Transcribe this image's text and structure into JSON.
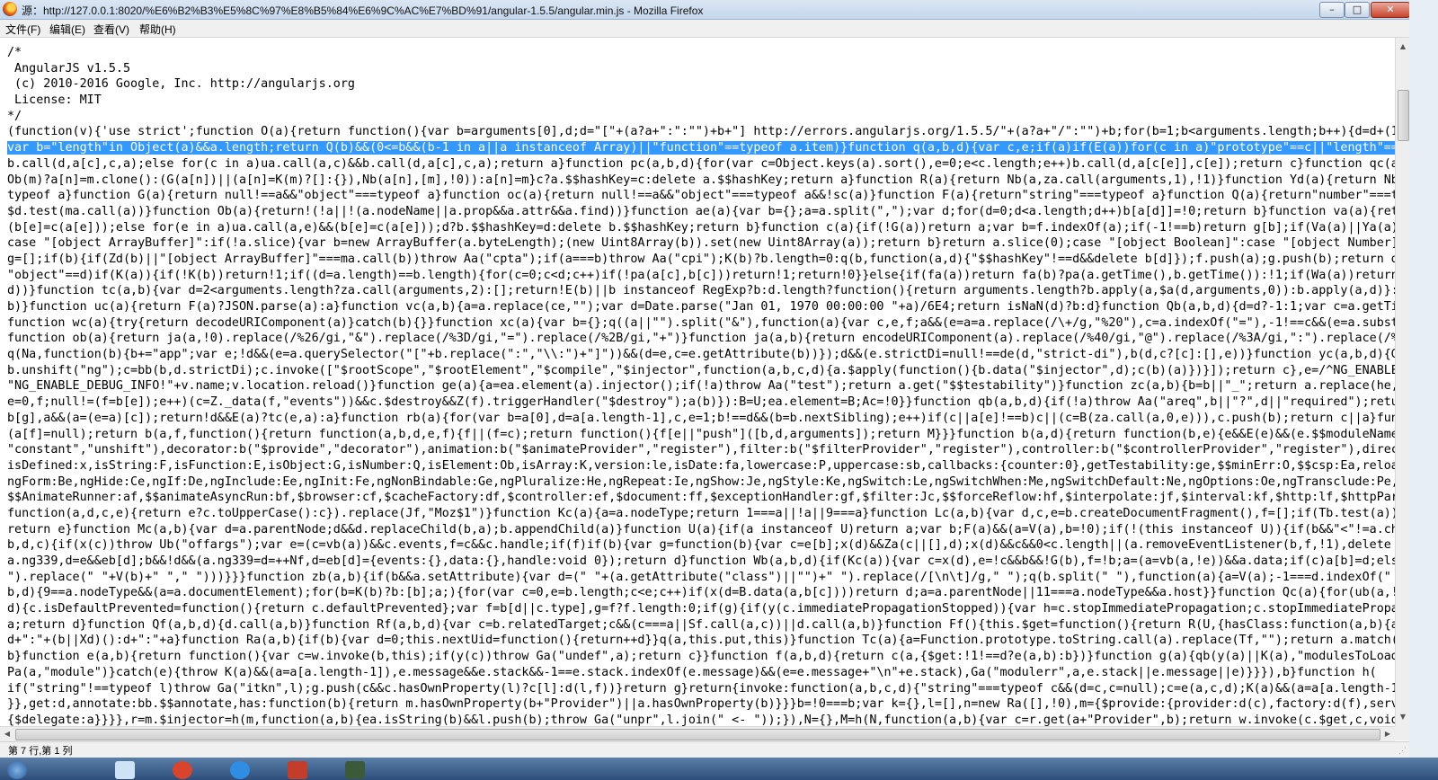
{
  "window": {
    "title": "源：http://127.0.0.1:8020/%E6%B2%B3%E5%8C%97%E8%B5%84%E6%9C%AC%E7%BD%91/angular-1.5.5/angular.min.js - Mozilla Firefox",
    "minimize": "–",
    "maximize": "□",
    "close": "✕"
  },
  "menu": [
    "文件(F)",
    "编辑(E)",
    "查看(V)",
    "帮助(H)"
  ],
  "code": {
    "pre_lines": [
      "/*",
      " AngularJS v1.5.5",
      " (c) 2010-2016 Google, Inc. http://angularjs.org",
      " License: MIT",
      "*/",
      "(function(v){'use strict';function O(a){return function(){var b=arguments[0],d;d=\"[\"+(a?a+\":\":\"\")+b+\"] http://errors.angularjs.org/1.5.5/\"+(a?a+\"/\":\"\")+b;for(b=1;b<arguments.length;b++){d=d+(1==b?\""
    ],
    "highlighted_line": "var b=\"length\"in Object(a)&&a.length;return Q(b)&&(0<=b&&(b-1 in a||a instanceof Array)||\"function\"==typeof a.item)}function q(a,b,d){var c,e;if(a)if(E(a))for(c in a)\"prototype\"==c||\"length\"==c||\"n",
    "post_lines": [
      "b.call(d,a[c],c,a);else for(c in a)ua.call(a,c)&&b.call(d,a[c],c,a);return a}function pc(a,b,d){for(var c=Object.keys(a).sort(),e=0;e<c.length;e++)b.call(d,a[c[e]],c[e]);return c}function qc(a){ret",
      "Ob(m)?a[n]=m.clone():(G(a[n])||(a[n]=K(m)?[]:{}),Nb(a[n],[m],!0)):a[n]=m}c?a.$$hashKey=c:delete a.$$hashKey;return a}function R(a){return Nb(a,za.call(arguments,1),!1)}function Yd(a){return Nb(a,z",
      "typeof a}function G(a){return null!==a&&\"object\"===typeof a}function oc(a){return null!==a&&\"object\"===typeof a&&!sc(a)}function F(a){return\"string\"===typeof a}function Q(a){return\"number\"===typeof",
      "$d.test(ma.call(a))}function Ob(a){return!(!a||!(a.nodeName||a.prop&&a.attr&&a.find))}function ae(a){var b={};a=a.split(\",\");var d;for(d=0;d<a.length;d++)b[a[d]]=!0;return b}function va(a){return P",
      "(b[e]=c(a[e]));else for(e in a)ua.call(a,e)&&(b[e]=c(a[e]));d?b.$$hashKey=d:delete b.$$hashKey;return b}function c(a){if(!G(a))return a;var b=f.indexOf(a);if(-1!==b)return g[b];if(Va(a)||Ya(a))thro",
      "case \"[object ArrayBuffer]\":if(!a.slice){var b=new ArrayBuffer(a.byteLength);(new Uint8Array(b)).set(new Uint8Array(a));return b}return a.slice(0);case \"[object Boolean]\":case \"[object Number]\":cas",
      "g=[];if(b){if(Zd(b)||\"[object ArrayBuffer]\"===ma.call(b))throw Aa(\"cpta\");if(a===b)throw Aa(\"cpi\");K(b)?b.length=0:q(b,function(a,d){\"$$hashKey\"!==d&&delete b[d]});f.push(a);g.push(b);return d(a,b)",
      "\"object\"==d)if(K(a)){if(!K(b))return!1;if((d=a.length)==b.length){for(c=0;c<d;c++)if(!pa(a[c],b[c]))return!1;return!0}}else{if(fa(a))return fa(b)?pa(a.getTime(),b.getTime()):!1;if(Wa(a))return Wa(b)",
      "d))}function tc(a,b){var d=2<arguments.length?za.call(arguments,2):[];return!E(b)||b instanceof RegExp?b:d.length?function(){return arguments.length?b.apply(a,$a(d,arguments,0)):b.apply(a,d)}:funct",
      "b)}function uc(a){return F(a)?JSON.parse(a):a}function vc(a,b){a=a.replace(ce,\"\");var d=Date.parse(\"Jan 01, 1970 00:00:00 \"+a)/6E4;return isNaN(d)?b:d}function Qb(a,b,d){d=d?-1:1;var c=a.getTimezon",
      "function wc(a){try{return decodeURIComponent(a)}catch(b){}}function xc(a){var b={};q((a||\"\").split(\"&\"),function(a){var c,e,f;a&&(e=a=a.replace(/\\+/g,\"%20\"),c=a.indexOf(\"=\"),-1!==c&&(e=a.substring(",
      "function ob(a){return ja(a,!0).replace(/%26/gi,\"&\").replace(/%3D/gi,\"=\").replace(/%2B/gi,\"+\")}function ja(a,b){return encodeURIComponent(a).replace(/%40/gi,\"@\").replace(/%3A/gi,\":\").replace(/%24/g,",
      "q(Na,function(b){b+=\"app\";var e;!d&&(e=a.querySelector(\"[\"+b.replace(\":\",\"\\\\:\")+\"]\"))&&(d=e,c=e.getAttribute(b))});d&&(e.strictDi=null!==de(d,\"strict-di\"),b(d,c?[c]:[],e))}function yc(a,b,d){G(d)||",
      "b.unshift(\"ng\");c=bb(b,d.strictDi);c.invoke([\"$rootScope\",\"$rootElement\",\"$compile\",\"$injector\",function(a,b,c,d){a.$apply(function(){b.data(\"$injector\",d);c(b)(a)})}]);return c},e=/^NG_ENABLE_DEBU",
      "\"NG_ENABLE_DEBUG_INFO!\"+v.name;v.location.reload()}function ge(a){a=ea.element(a).injector();if(!a)throw Aa(\"test\");return a.get(\"$$testability\")}function zc(a,b){b=b||\"_\";return a.replace(he,funct",
      "e=0,f;null!=(f=b[e]);e++)(c=Z._data(f,\"events\"))&&c.$destroy&&Z(f).triggerHandler(\"$destroy\");a(b)}):B=U;ea.element=B;Ac=!0}}function qb(a,b,d){if(!a)throw Aa(\"areq\",b||\"?\",d||\"required\");return a}",
      "b[g],a&&(a=(e=a)[c]);return!d&&E(a)?tc(e,a):a}function rb(a){for(var b=a[0],d=a[a.length-1],c,e=1;b!==d&&(b=b.nextSibling);e++)if(c||a[e]!==b)c||(c=B(za.call(a,0,e))),c.push(b);return c||a}function",
      "(a[f]=null);return b(a,f,function(){return function(a,b,d,e,f){f||(f=c);return function(){f[e||\"push\"]([b,d,arguments]);return M}}}function b(a,d){return function(b,e){e&&E(e)&&(e.$$moduleName=f);c.push(a",
      "\"constant\",\"unshift\"),decorator:b(\"$provide\",\"decorator\"),animation:b(\"$animateProvider\",\"register\"),filter:b(\"$filterProvider\",\"register\"),controller:b(\"$controllerProvider\",\"register\"),directive:",
      "isDefined:x,isString:F,isFunction:E,isObject:G,isNumber:Q,isElement:Ob,isArray:K,version:le,isDate:fa,lowercase:P,uppercase:sb,callbacks:{counter:0},getTestability:ge,$$minErr:O,$$csp:Ea,reloadWith",
      "ngForm:Be,ngHide:Ce,ngIf:De,ngInclude:Ee,ngInit:Fe,ngNonBindable:Ge,ngPluralize:He,ngRepeat:Ie,ngShow:Je,ngStyle:Ke,ngSwitch:Le,ngSwitchWhen:Me,ngSwitchDefault:Ne,ngOptions:Oe,ngTransclude:Pe,ngMod",
      "$$AnimateRunner:af,$$animateAsyncRun:bf,$browser:cf,$cacheFactory:df,$controller:ef,$document:ff,$exceptionHandler:gf,$filter:Jc,$$forceReflow:hf,$interpolate:jf,$interval:kf,$http:lf,$httpParamSer",
      "function(a,d,c,e){return e?c.toUpperCase():c}).replace(Jf,\"Moz$1\")}function Kc(a){a=a.nodeType;return 1===a||!a||9===a}function Lc(a,b){var d,c,e=b.createDocumentFragment(),f=[];if(Tb.test(a)){d=d",
      "return e}function Mc(a,b){var d=a.parentNode;d&&d.replaceChild(b,a);b.appendChild(a)}function U(a){if(a instanceof U)return a;var b;F(a)&&(a=V(a),b=!0);if(!(this instanceof U)){if(b&&\"<\"!=a.charAt(",
      "b,d,c){if(x(c))throw Ub(\"offargs\");var e=(c=vb(a))&&c.events,f=c&&c.handle;if(f)if(b){var g=function(b){var c=e[b];x(d)&&Za(c||[],d);x(d)&&c&&0<c.length||(a.removeEventListener(b,f,!1),delete e[b]}",
      "a.ng339,d=e&&eb[d];b&&!d&&(a.ng339=d=++Nf,d=eb[d]={events:{},data:{},handle:void 0});return d}function Wb(a,b,d){if(Kc(a)){var c=x(d),e=!c&&b&&!G(b),f=!b;a=(a=vb(a,!e))&&a.data;if(c)a[b]=d;else{if(",
      "\").replace(\" \"+V(b)+\" \",\" \")))}}}function zb(a,b){if(b&&a.setAttribute){var d=(\" \"+(a.getAttribute(\"class\")||\"\")+\" \").replace(/[\\n\\t]/g,\" \");q(b.split(\" \"),function(a){a=V(a);-1===d.indexOf(\" \"+a",
      "b,d){9==a.nodeType&&(a=a.documentElement);for(b=K(b)?b:[b];a;){for(var c=0,e=b.length;c<e;c++)if(x(d=B.data(a,b[c])))return d;a=a.parentNode||11===a.nodeType&&a.host}}function Qc(a){for(ub(a,!0);a.",
      "d){c.isDefaultPrevented=function(){return c.defaultPrevented};var f=b[d||c.type],g=f?f.length:0;if(g){if(y(c.immediatePropagationStopped)){var h=c.stopImmediatePropagation;c.stopImmediatePropagatio",
      "a;return d}function Qf(a,b,d){d.call(a,b)}function Rf(a,b,d){var c=b.relatedTarget;c&&(c===a||Sf.call(a,c))||d.call(a,b)}function Ff(){this.$get=function(){return R(U,{hasClass:function(a,b){a.attr",
      "d+\":\"+(b||Xd)():d+\":\"+a}function Ra(a,b){if(b){var d=0;this.nextUid=function(){return++d}}q(a,this.put,this)}function Tc(a){a=Function.prototype.toString.call(a).replace(Tf,\"\");return a.match(Uf)||",
      "b}function e(a,b){return function(){var c=w.invoke(b,this);if(y(c))throw Ga(\"undef\",a);return c}}function f(a,b,d){return c(a,{$get:!1!==d?e(a,b):b})}function g(a){qb(y(a)||K(a),\"modulesToLoad\",\"no",
      "Pa(a,\"module\")}catch(e){throw K(a)&&(a=a[a.length-1]),e.message&&e.stack&&-1==e.stack.indexOf(e.message)&&(e=e.message+\"\\n\"+e.stack),Ga(\"modulerr\",a,e.stack||e.message||e)}}}),b}function h(",
      "if(\"string\"!==typeof l)throw Ga(\"itkn\",l);g.push(c&&c.hasOwnProperty(l)?c[l]:d(l,f))}return g}return{invoke:function(a,b,c,d){\"string\"===typeof c&&(d=c,c=null);c=e(a,c,d);K(a)&&(a=a[a.length-1]);d=",
      "}},get:d,annotate:bb.$$annotate,has:function(b){return m.hasOwnProperty(b+\"Provider\")||a.hasOwnProperty(b)}}}b=!0===b;var k={},l=[],n=new Ra([],!0),m={$provide:{provider:d(c),factory:d(f),service",
      "{$delegate:a}}}},r=m.$injector=h(m,function(a,b){ea.isString(b)&&l.push(b);throw Ga(\"unpr\",l.join(\" <- \"));}),N={},M=h(N,function(a,b){var c=r.get(a+\"Provider\",b);return w.invoke(c.$get,c,void 0,"
    ]
  },
  "status": "第 7 行,第 1 列"
}
